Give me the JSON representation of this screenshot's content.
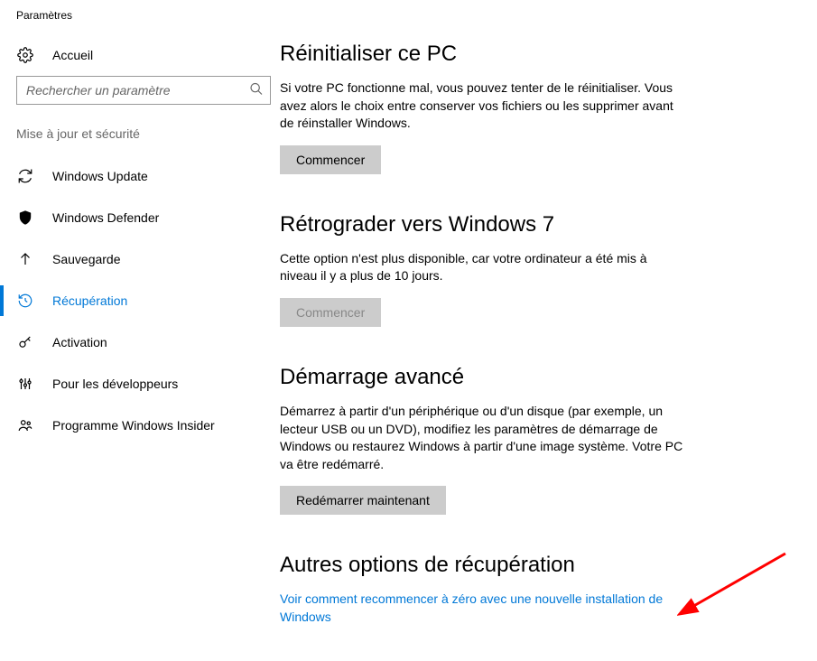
{
  "window_title": "Paramètres",
  "home_label": "Accueil",
  "search_placeholder": "Rechercher un paramètre",
  "category_header": "Mise à jour et sécurité",
  "nav": [
    {
      "label": "Windows Update"
    },
    {
      "label": "Windows Defender"
    },
    {
      "label": "Sauvegarde"
    },
    {
      "label": "Récupération"
    },
    {
      "label": "Activation"
    },
    {
      "label": "Pour les développeurs"
    },
    {
      "label": "Programme Windows Insider"
    }
  ],
  "sections": {
    "reset": {
      "title": "Réinitialiser ce PC",
      "body": "Si votre PC fonctionne mal, vous pouvez tenter de le réinitialiser. Vous avez alors le choix entre conserver vos fichiers ou les supprimer avant de réinstaller Windows.",
      "button": "Commencer"
    },
    "downgrade": {
      "title": "Rétrograder vers Windows 7",
      "body": "Cette option n'est plus disponible, car votre ordinateur a été mis à niveau il y a plus de 10 jours.",
      "button": "Commencer"
    },
    "advanced": {
      "title": "Démarrage avancé",
      "body": "Démarrez à partir d'un périphérique ou d'un disque (par exemple, un lecteur USB ou un DVD), modifiez les paramètres de démarrage de Windows ou restaurez Windows à partir d'une image système. Votre PC va être redémarré.",
      "button": "Redémarrer maintenant"
    },
    "other": {
      "title": "Autres options de récupération",
      "link": "Voir comment recommencer à zéro avec une nouvelle installation de Windows"
    }
  }
}
